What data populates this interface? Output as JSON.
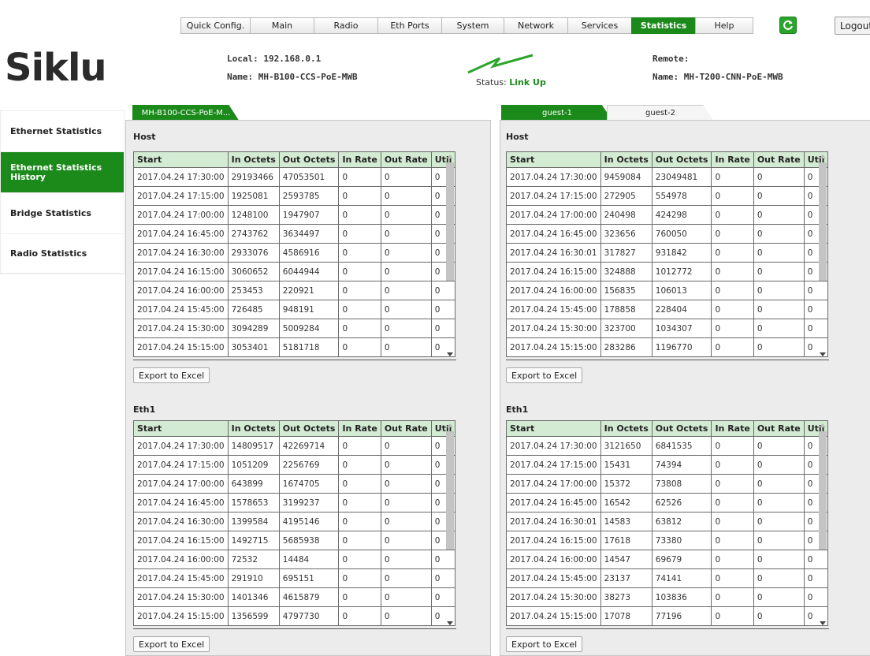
{
  "nav": {
    "tabs": [
      {
        "label": "Quick Config."
      },
      {
        "label": "Main"
      },
      {
        "label": "Radio"
      },
      {
        "label": "Eth Ports"
      },
      {
        "label": "System"
      },
      {
        "label": "Network"
      },
      {
        "label": "Services"
      },
      {
        "label": "Statistics",
        "active": true
      },
      {
        "label": "Help"
      }
    ],
    "logout_label": "Logout"
  },
  "logo": {
    "text": "Siklu"
  },
  "header": {
    "local": "Local: 192.168.0.1",
    "local_name": "Name: MH-B100-CCS-PoE-MWB",
    "remote": "Remote:",
    "remote_name": "Name: MH-T200-CNN-PoE-MWB",
    "status_label": "Status:",
    "status_value": "Link Up"
  },
  "sidebar": {
    "items": [
      {
        "label": "Ethernet Statistics"
      },
      {
        "label": "Ethernet Statistics History",
        "active": true
      },
      {
        "label": "Bridge Statistics"
      },
      {
        "label": "Radio Statistics"
      }
    ]
  },
  "columns": [
    "Start",
    "In Octets",
    "Out Octets",
    "In Rate",
    "Out Rate",
    "Util"
  ],
  "export_label": "Export to Excel",
  "left_panel": {
    "tab": "MH-B100-CCS-PoE-M...",
    "host_title": "Host",
    "host_rows": [
      [
        "2017.04.24 17:30:00",
        "29193466",
        "47053501",
        "0",
        "0",
        "0"
      ],
      [
        "2017.04.24 17:15:00",
        "1925081",
        "2593785",
        "0",
        "0",
        "0"
      ],
      [
        "2017.04.24 17:00:00",
        "1248100",
        "1947907",
        "0",
        "0",
        "0"
      ],
      [
        "2017.04.24 16:45:00",
        "2743762",
        "3634497",
        "0",
        "0",
        "0"
      ],
      [
        "2017.04.24 16:30:00",
        "2933076",
        "4586916",
        "0",
        "0",
        "0"
      ],
      [
        "2017.04.24 16:15:00",
        "3060652",
        "6044944",
        "0",
        "0",
        "0"
      ],
      [
        "2017.04.24 16:00:00",
        "253453",
        "220921",
        "0",
        "0",
        "0"
      ],
      [
        "2017.04.24 15:45:00",
        "726485",
        "948191",
        "0",
        "0",
        "0"
      ],
      [
        "2017.04.24 15:30:00",
        "3094289",
        "5009284",
        "0",
        "0",
        "0"
      ],
      [
        "2017.04.24 15:15:00",
        "3053401",
        "5181718",
        "0",
        "0",
        "0"
      ]
    ],
    "eth_title": "Eth1",
    "eth_rows": [
      [
        "2017.04.24 17:30:00",
        "14809517",
        "42269714",
        "0",
        "0",
        "0"
      ],
      [
        "2017.04.24 17:15:00",
        "1051209",
        "2256769",
        "0",
        "0",
        "0"
      ],
      [
        "2017.04.24 17:00:00",
        "643899",
        "1674705",
        "0",
        "0",
        "0"
      ],
      [
        "2017.04.24 16:45:00",
        "1578653",
        "3199237",
        "0",
        "0",
        "0"
      ],
      [
        "2017.04.24 16:30:00",
        "1399584",
        "4195146",
        "0",
        "0",
        "0"
      ],
      [
        "2017.04.24 16:15:00",
        "1492715",
        "5685938",
        "0",
        "0",
        "0"
      ],
      [
        "2017.04.24 16:00:00",
        "72532",
        "14484",
        "0",
        "0",
        "0"
      ],
      [
        "2017.04.24 15:45:00",
        "291910",
        "695151",
        "0",
        "0",
        "0"
      ],
      [
        "2017.04.24 15:30:00",
        "1401346",
        "4615879",
        "0",
        "0",
        "0"
      ],
      [
        "2017.04.24 15:15:00",
        "1356599",
        "4797730",
        "0",
        "0",
        "0"
      ]
    ]
  },
  "right_panel": {
    "tabs": [
      "guest-1",
      "guest-2"
    ],
    "host_title": "Host",
    "host_rows": [
      [
        "2017.04.24 17:30:00",
        "9459084",
        "23049481",
        "0",
        "0",
        "0"
      ],
      [
        "2017.04.24 17:15:00",
        "272905",
        "554978",
        "0",
        "0",
        "0"
      ],
      [
        "2017.04.24 17:00:00",
        "240498",
        "424298",
        "0",
        "0",
        "0"
      ],
      [
        "2017.04.24 16:45:00",
        "323656",
        "760050",
        "0",
        "0",
        "0"
      ],
      [
        "2017.04.24 16:30:01",
        "317827",
        "931842",
        "0",
        "0",
        "0"
      ],
      [
        "2017.04.24 16:15:00",
        "324888",
        "1012772",
        "0",
        "0",
        "0"
      ],
      [
        "2017.04.24 16:00:00",
        "156835",
        "106013",
        "0",
        "0",
        "0"
      ],
      [
        "2017.04.24 15:45:00",
        "178858",
        "228404",
        "0",
        "0",
        "0"
      ],
      [
        "2017.04.24 15:30:00",
        "323700",
        "1034307",
        "0",
        "0",
        "0"
      ],
      [
        "2017.04.24 15:15:00",
        "283286",
        "1196770",
        "0",
        "0",
        "0"
      ]
    ],
    "eth_title": "Eth1",
    "eth_rows": [
      [
        "2017.04.24 17:30:00",
        "3121650",
        "6841535",
        "0",
        "0",
        "0"
      ],
      [
        "2017.04.24 17:15:00",
        "15431",
        "74394",
        "0",
        "0",
        "0"
      ],
      [
        "2017.04.24 17:00:00",
        "15372",
        "73808",
        "0",
        "0",
        "0"
      ],
      [
        "2017.04.24 16:45:00",
        "16542",
        "62526",
        "0",
        "0",
        "0"
      ],
      [
        "2017.04.24 16:30:01",
        "14583",
        "63812",
        "0",
        "0",
        "0"
      ],
      [
        "2017.04.24 16:15:00",
        "17618",
        "73380",
        "0",
        "0",
        "0"
      ],
      [
        "2017.04.24 16:00:00",
        "14547",
        "69679",
        "0",
        "0",
        "0"
      ],
      [
        "2017.04.24 15:45:00",
        "23137",
        "74141",
        "0",
        "0",
        "0"
      ],
      [
        "2017.04.24 15:30:00",
        "38273",
        "103836",
        "0",
        "0",
        "0"
      ],
      [
        "2017.04.24 15:15:00",
        "17078",
        "77196",
        "0",
        "0",
        "0"
      ]
    ]
  },
  "colors": {
    "accent": "#1b8a1b",
    "header_row": "#d3ead3"
  }
}
